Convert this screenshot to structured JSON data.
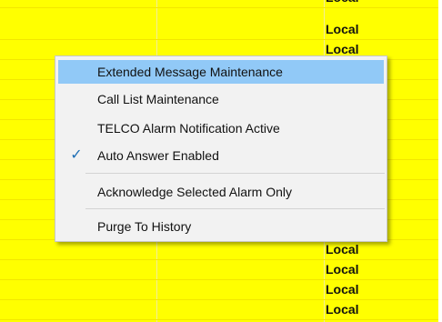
{
  "grid": {
    "rows": [
      "Local",
      "Local",
      "Local",
      "",
      "",
      "",
      "",
      "",
      "",
      "",
      "",
      "",
      "Local",
      "Local",
      "Local",
      "Local"
    ]
  },
  "context_menu": {
    "items": [
      {
        "label": "Extended Message Maintenance",
        "highlighted": true,
        "checked": false
      },
      {
        "label": "Call List Maintenance",
        "highlighted": false,
        "checked": false
      },
      {
        "label": "TELCO Alarm Notification Active",
        "highlighted": false,
        "checked": false
      },
      {
        "label": "Auto Answer  Enabled",
        "highlighted": false,
        "checked": true
      },
      {
        "label": "Acknowledge Selected Alarm Only",
        "highlighted": false,
        "checked": false
      },
      {
        "label": "Purge To History",
        "highlighted": false,
        "checked": false
      }
    ],
    "check_glyph": "✓"
  },
  "colors": {
    "grid_background": "#ffff00",
    "menu_highlight": "#91c9f7",
    "menu_background": "#f2f2f2"
  }
}
